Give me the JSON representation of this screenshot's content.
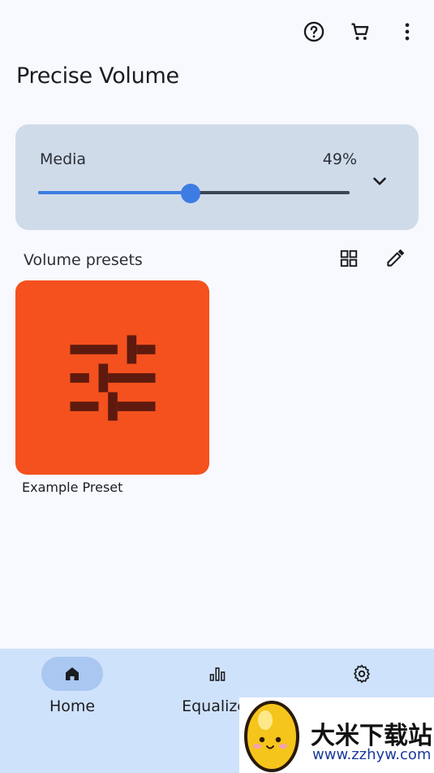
{
  "header": {
    "title": "Precise Volume",
    "icons": [
      "help-icon",
      "cart-icon",
      "more-vert-icon"
    ]
  },
  "volume_card": {
    "label": "Media",
    "percent_text": "49%",
    "level": 0.49,
    "accent": "#3d7ce2",
    "background": "#d0dbea"
  },
  "presets": {
    "header": "Volume presets",
    "items": [
      {
        "label": "Example Preset",
        "color": "#f4511e",
        "icon": "tune-icon"
      }
    ]
  },
  "bottom_nav": {
    "items": [
      {
        "label": "Home",
        "icon": "home-icon",
        "active": true
      },
      {
        "label": "Equalizer",
        "icon": "equalizer-icon",
        "active": false
      },
      {
        "label": "",
        "icon": "settings-icon",
        "active": false
      }
    ]
  },
  "watermark": {
    "text": "大米下载站",
    "url": "www.zzhyw.com"
  }
}
